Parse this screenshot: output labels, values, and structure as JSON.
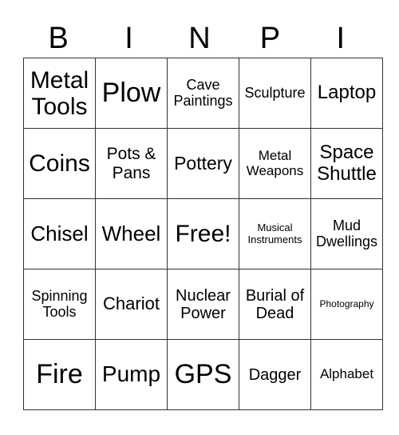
{
  "header": [
    "B",
    "I",
    "N",
    "P",
    "I"
  ],
  "rows": [
    [
      {
        "text": "Metal Tools",
        "size": 30
      },
      {
        "text": "Plow",
        "size": 34
      },
      {
        "text": "Cave Paintings",
        "size": 18
      },
      {
        "text": "Sculpture",
        "size": 18
      },
      {
        "text": "Laptop",
        "size": 24
      }
    ],
    [
      {
        "text": "Coins",
        "size": 30
      },
      {
        "text": "Pots & Pans",
        "size": 21
      },
      {
        "text": "Pottery",
        "size": 23
      },
      {
        "text": "Metal Weapons",
        "size": 17
      },
      {
        "text": "Space Shuttle",
        "size": 24
      }
    ],
    [
      {
        "text": "Chisel",
        "size": 26
      },
      {
        "text": "Wheel",
        "size": 26
      },
      {
        "text": "Free!",
        "size": 30
      },
      {
        "text": "Musical Instruments",
        "size": 13
      },
      {
        "text": "Mud Dwellings",
        "size": 18
      }
    ],
    [
      {
        "text": "Spinning Tools",
        "size": 18
      },
      {
        "text": "Chariot",
        "size": 22
      },
      {
        "text": "Nuclear Power",
        "size": 20
      },
      {
        "text": "Burial of Dead",
        "size": 20
      },
      {
        "text": "Photography",
        "size": 12
      }
    ],
    [
      {
        "text": "Fire",
        "size": 34
      },
      {
        "text": "Pump",
        "size": 28
      },
      {
        "text": "GPS",
        "size": 34
      },
      {
        "text": "Dagger",
        "size": 20
      },
      {
        "text": "Alphabet",
        "size": 17
      }
    ]
  ]
}
